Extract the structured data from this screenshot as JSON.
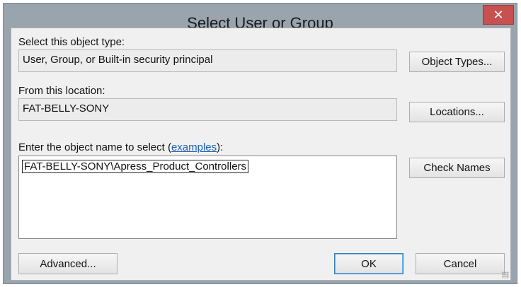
{
  "window": {
    "title": "Select User or Group",
    "close_label": "✕"
  },
  "object_type": {
    "label": "Select this object type:",
    "value": "User, Group, or Built-in security principal",
    "button": "Object Types..."
  },
  "location": {
    "label": "From this location:",
    "value": "FAT-BELLY-SONY",
    "button": "Locations..."
  },
  "object_name": {
    "label_prefix": "Enter the object name to select (",
    "link": "examples",
    "label_suffix": "):",
    "value": "FAT-BELLY-SONY\\Apress_Product_Controllers",
    "button": "Check Names"
  },
  "footer": {
    "advanced": "Advanced...",
    "ok": "OK",
    "cancel": "Cancel"
  }
}
